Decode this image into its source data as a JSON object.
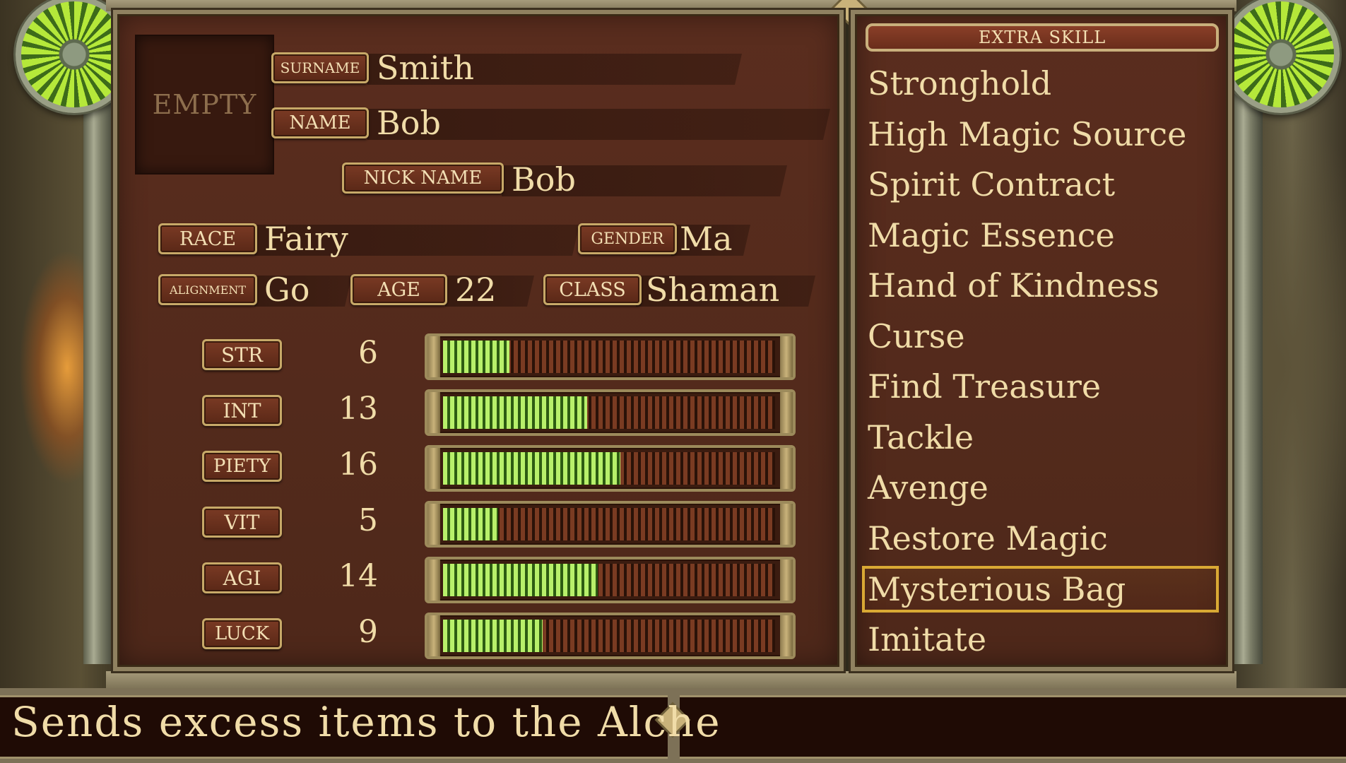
{
  "character": {
    "portrait_label": "EMPTY",
    "surname": {
      "label": "Surname",
      "value": "Smith"
    },
    "name": {
      "label": "Name",
      "value": "Bob"
    },
    "nickname": {
      "label": "Nick Name",
      "value": "Bob"
    },
    "race": {
      "label": "Race",
      "value": "Fairy"
    },
    "gender": {
      "label": "Gender",
      "value": "Ma"
    },
    "alignment": {
      "label": "Alignment",
      "value": "Go"
    },
    "age": {
      "label": "Age",
      "value": "22"
    },
    "class": {
      "label": "Class",
      "value": "Shaman"
    }
  },
  "stats": [
    {
      "label": "STR",
      "value": "6",
      "max": 30
    },
    {
      "label": "INT",
      "value": "13",
      "max": 30
    },
    {
      "label": "PIETY",
      "value": "16",
      "max": 30
    },
    {
      "label": "VIT",
      "value": "5",
      "max": 30
    },
    {
      "label": "AGI",
      "value": "14",
      "max": 30
    },
    {
      "label": "LUCK",
      "value": "9",
      "max": 30
    }
  ],
  "skills": {
    "header": "EXTRA SKILL",
    "items": [
      {
        "label": "Stronghold"
      },
      {
        "label": "High Magic Source"
      },
      {
        "label": "Spirit Contract"
      },
      {
        "label": "Magic Essence"
      },
      {
        "label": "Hand of Kindness"
      },
      {
        "label": "Curse"
      },
      {
        "label": "Find Treasure"
      },
      {
        "label": "Tackle"
      },
      {
        "label": "Avenge"
      },
      {
        "label": "Restore Magic"
      },
      {
        "label": "Mysterious Bag",
        "selected": true
      },
      {
        "label": "Imitate"
      }
    ]
  },
  "description": "Sends excess items to the Alche",
  "colors": {
    "bar_fill": "#b8f06a",
    "selection": "#d9a934",
    "text": "#f0dca8"
  }
}
